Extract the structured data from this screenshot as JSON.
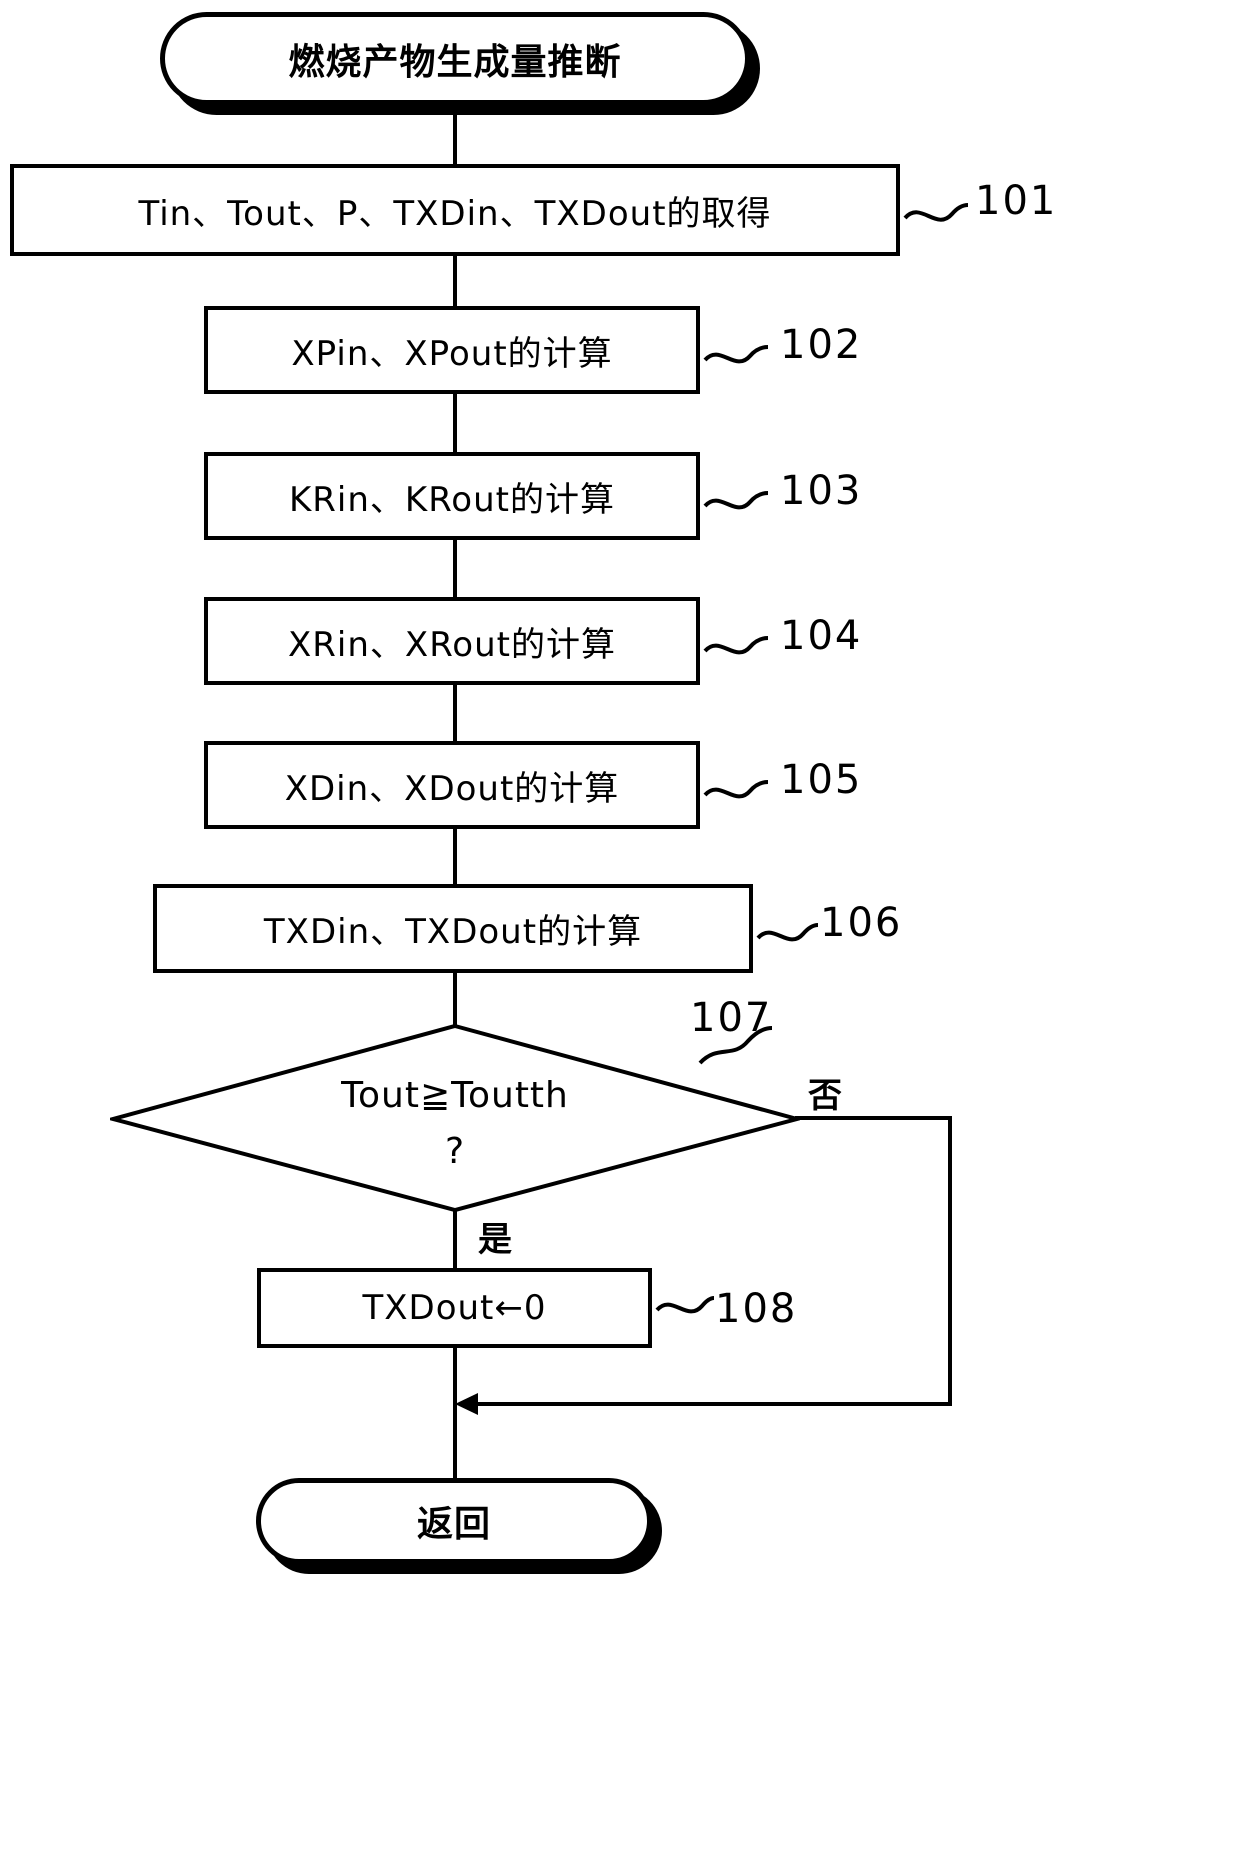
{
  "diagram": {
    "type": "flowchart",
    "title": "燃烧产物生成量推断",
    "start": {
      "label": "燃烧产物生成量推断",
      "shape": "terminator"
    },
    "steps": [
      {
        "ref": "101",
        "label": "Tin、Tout、P、TXDin、TXDout的取得",
        "shape": "process"
      },
      {
        "ref": "102",
        "label": "XPin、XPout的计算",
        "shape": "process"
      },
      {
        "ref": "103",
        "label": "KRin、KRout的计算",
        "shape": "process"
      },
      {
        "ref": "104",
        "label": "XRin、XRout的计算",
        "shape": "process"
      },
      {
        "ref": "105",
        "label": "XDin、XDout的计算",
        "shape": "process"
      },
      {
        "ref": "106",
        "label": "TXDin、TXDout的计算",
        "shape": "process"
      }
    ],
    "decision": {
      "ref": "107",
      "condition": "Tout≧Toutth",
      "question_mark": "?",
      "yes_label": "是",
      "no_label": "否",
      "shape": "decision"
    },
    "action": {
      "ref": "108",
      "label": "TXDout←0",
      "shape": "process"
    },
    "end": {
      "label": "返回",
      "shape": "terminator"
    },
    "colors": {
      "stroke": "#000000",
      "fill": "#ffffff",
      "text": "#000000"
    }
  }
}
